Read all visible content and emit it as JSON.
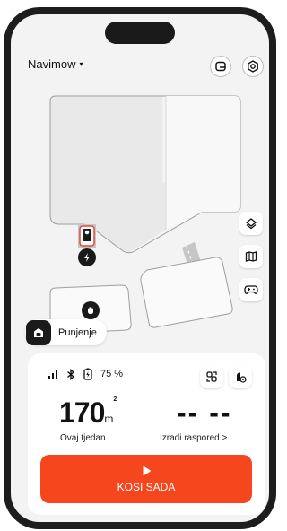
{
  "header": {
    "device_name": "Navimow",
    "caret": "▾"
  },
  "toolbar_icons": [
    "message-icon",
    "settings-icon"
  ],
  "map_controls": [
    "layers-icon",
    "map-icon",
    "gamepad-icon"
  ],
  "dock": {
    "label": "Punjenje"
  },
  "status": {
    "signal_icon": "signal-icon",
    "bluetooth_icon": "bluetooth-icon",
    "battery_icon": "battery-charging-icon",
    "battery_percent": "75 %"
  },
  "stats": {
    "mowed_value": "170",
    "mowed_unit": "m",
    "mowed_unit_sup": "2",
    "mowed_caption": "Ovaj tjedan",
    "schedule_value": "-- --",
    "schedule_caption": "Izradi raspored >"
  },
  "cta": {
    "label": "KOSI SADA"
  },
  "colors": {
    "accent": "#f5461d",
    "dark": "#1a1a1a",
    "map_zone": "#f5f5f5",
    "map_border": "#9e9e9e"
  }
}
